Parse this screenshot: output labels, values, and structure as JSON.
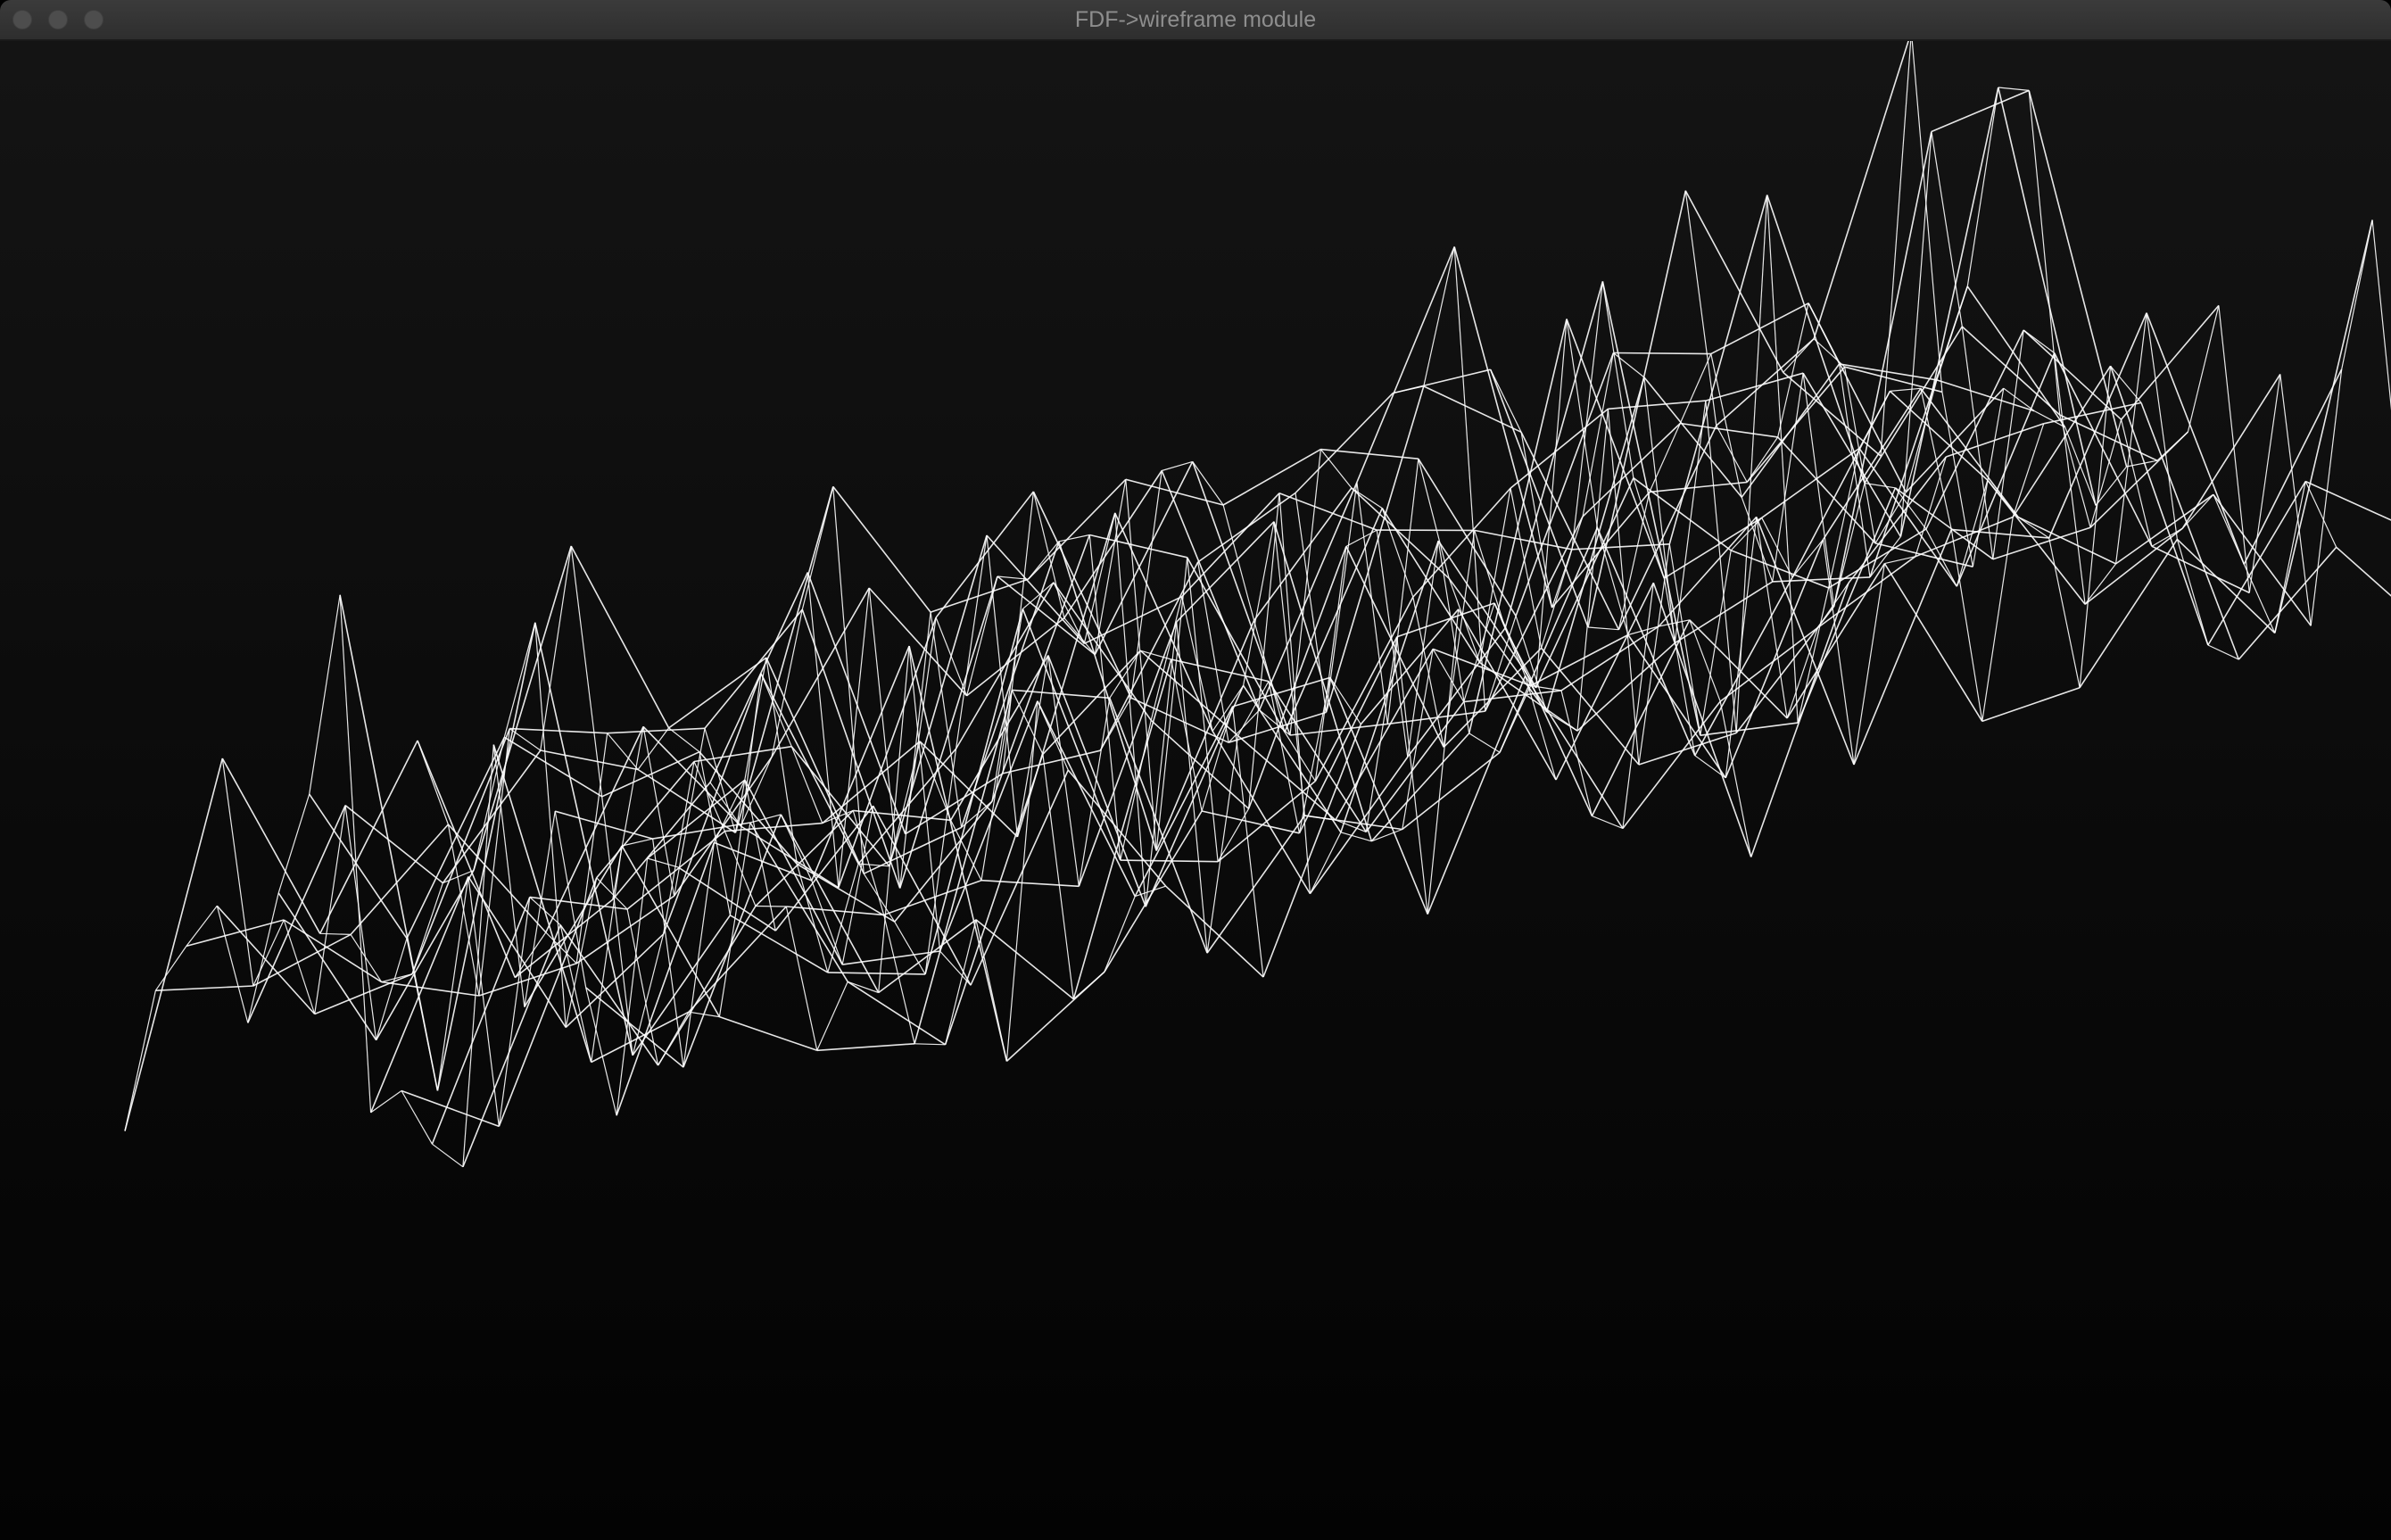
{
  "window": {
    "title": "FDF->wireframe module"
  },
  "controls": {
    "close_icon": "close-icon",
    "minimize_icon": "minimize-icon",
    "zoom_icon": "zoom-icon"
  },
  "wireframe": {
    "line_color": "#ffffff",
    "background_color": "#0a0a0a"
  }
}
